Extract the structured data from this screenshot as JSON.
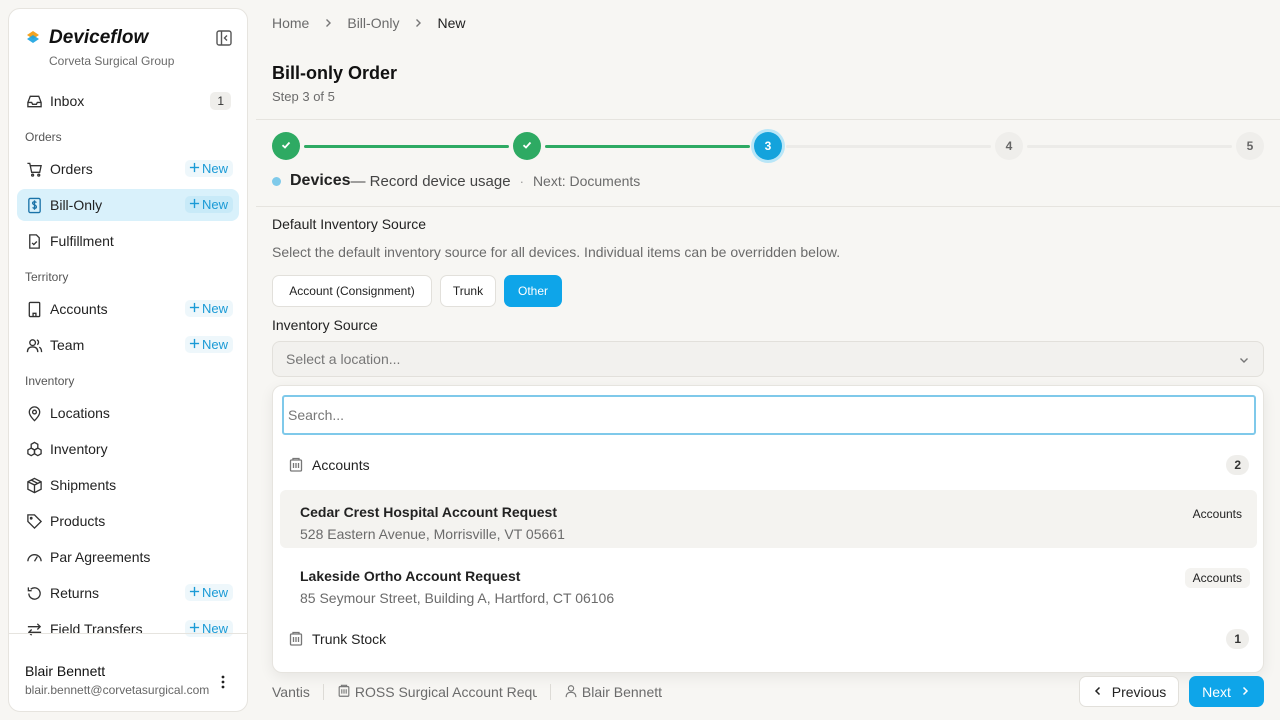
{
  "app": {
    "name": "Deviceflow",
    "org": "Corveta Surgical Group"
  },
  "sidebar": {
    "inbox": {
      "label": "Inbox",
      "count": "1"
    },
    "sections": {
      "orders": "Orders",
      "territory": "Territory",
      "inventory": "Inventory"
    },
    "items": {
      "orders": {
        "label": "Orders",
        "new_label": "New"
      },
      "bill_only": {
        "label": "Bill-Only",
        "new_label": "New"
      },
      "fulfillment": {
        "label": "Fulfillment"
      },
      "accounts": {
        "label": "Accounts",
        "new_label": "New"
      },
      "team": {
        "label": "Team",
        "new_label": "New"
      },
      "locations": {
        "label": "Locations"
      },
      "inventory": {
        "label": "Inventory"
      },
      "shipments": {
        "label": "Shipments"
      },
      "products": {
        "label": "Products"
      },
      "par_agreements": {
        "label": "Par Agreements"
      },
      "returns": {
        "label": "Returns",
        "new_label": "New"
      },
      "field_transfers": {
        "label": "Field Transfers",
        "new_label": "New"
      }
    },
    "user": {
      "name": "Blair Bennett",
      "email": "blair.bennett@corvetasurgical.com"
    }
  },
  "breadcrumb": [
    "Home",
    "Bill-Only",
    "New"
  ],
  "page": {
    "title": "Bill-only Order",
    "step": "Step 3 of 5"
  },
  "stepper": {
    "current": "3",
    "todo": [
      "4",
      "5"
    ]
  },
  "step_caption": {
    "label": "Devices",
    "desc": "— Record device usage",
    "sep": "·",
    "next": "Next: Documents"
  },
  "inventory_source": {
    "heading": "Default Inventory Source",
    "description": "Select the default inventory source for all devices. Individual items can be overridden below.",
    "options": [
      "Account (Consignment)",
      "Trunk",
      "Other"
    ],
    "selected": "Other",
    "select_label": "Inventory Source",
    "select_placeholder": "Select a location..."
  },
  "dropdown": {
    "search_placeholder": "Search...",
    "groups": [
      {
        "label": "Accounts",
        "count": "2",
        "options": [
          {
            "title": "Cedar Crest Hospital Account Request",
            "address": "528 Eastern Avenue, Morrisville, VT 05661",
            "tag": "Accounts"
          },
          {
            "title": "Lakeside Ortho Account Request",
            "address": "85 Seymour Street, Building A, Hartford, CT 06106",
            "tag": "Accounts"
          }
        ]
      },
      {
        "label": "Trunk Stock",
        "count": "1"
      }
    ]
  },
  "footer": {
    "company": "Vantis",
    "account": "ROSS Surgical Account Request",
    "rep": "Blair Bennett",
    "prev_label": "Previous",
    "next_label": "Next"
  },
  "colors": {
    "accent": "#0ea5e9",
    "success": "#2eaa63",
    "active_nav_bg": "#d9f1fb"
  }
}
